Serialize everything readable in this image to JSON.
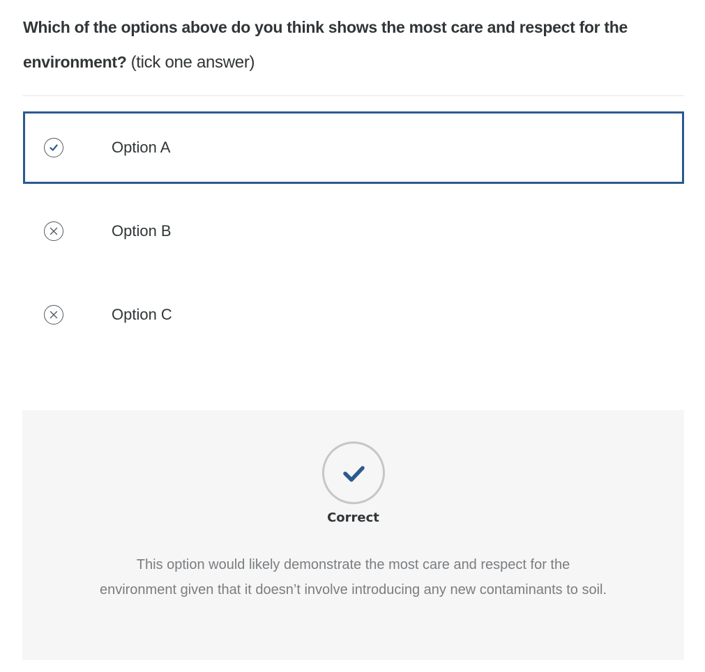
{
  "question": {
    "bold_text": "Which of the options above do you think shows the most care and respect for the environment?",
    "note": "(tick one answer)"
  },
  "options": [
    {
      "label": "Option A",
      "state": "correct-selected",
      "icon": "check-icon"
    },
    {
      "label": "Option B",
      "state": "incorrect",
      "icon": "close-icon"
    },
    {
      "label": "Option C",
      "state": "incorrect",
      "icon": "close-icon"
    }
  ],
  "feedback": {
    "result_icon": "check-icon",
    "result_label": "Correct",
    "explanation": "This option would likely demonstrate the most care and respect for the environment given that it doesn’t involve introducing any new contaminants to soil."
  },
  "colors": {
    "accent": "#2a5a8f",
    "feedback_background": "#f6f6f6",
    "text": "#313537",
    "muted_text": "#7a7d80"
  }
}
